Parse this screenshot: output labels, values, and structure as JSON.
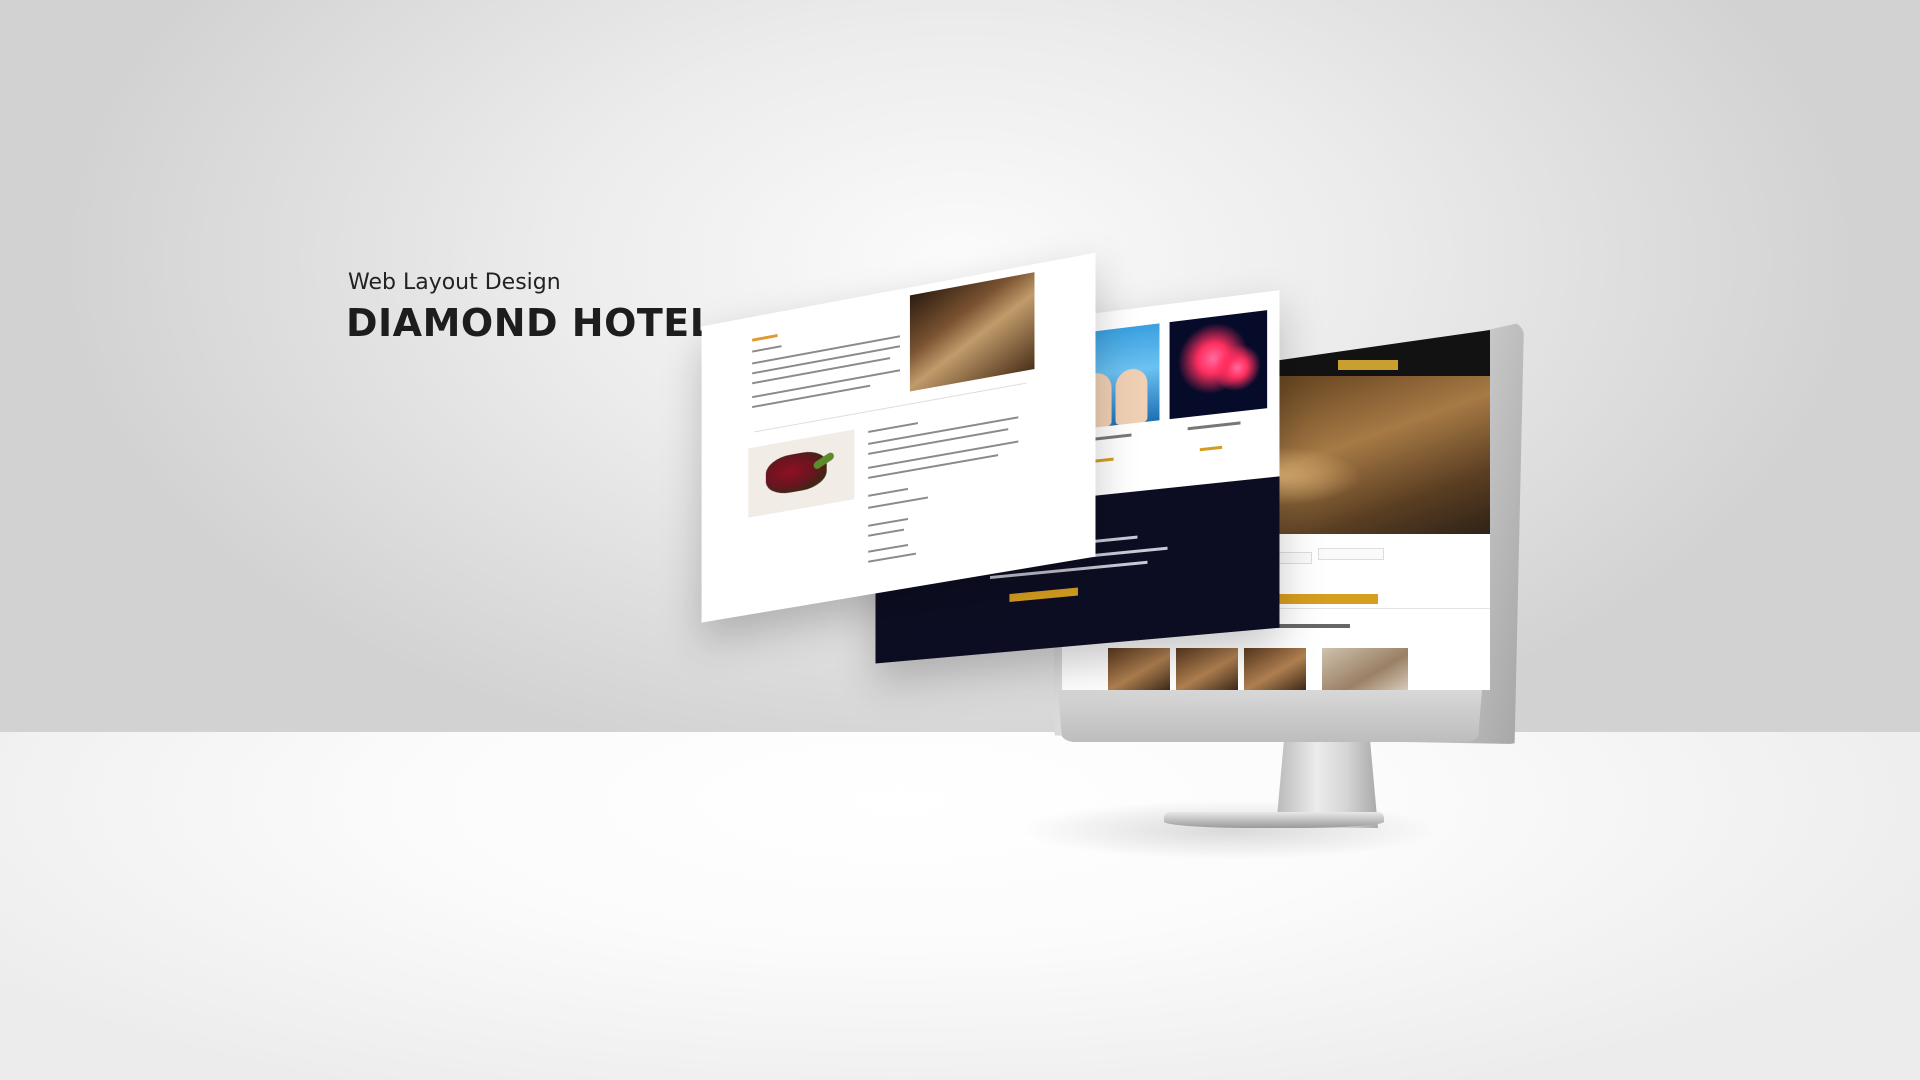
{
  "heading": {
    "subtitle": "Web Layout Design",
    "title": "DIAMOND HOTEL"
  }
}
